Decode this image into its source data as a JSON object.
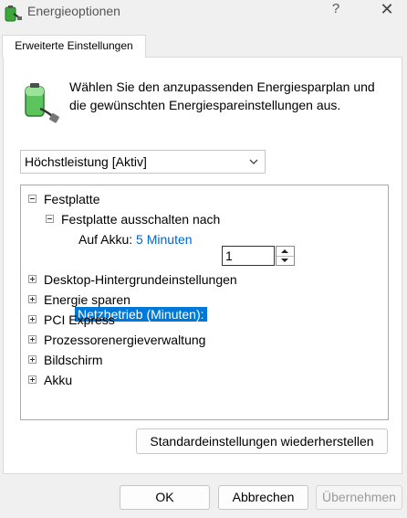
{
  "window": {
    "title": "Energieoptionen",
    "help_glyph": "?",
    "close_glyph": "✕"
  },
  "tab": {
    "label": "Erweiterte Einstellungen"
  },
  "description": "Wählen Sie den anzupassenden Energiesparplan und die gewünschten Energiespareinstellungen aus.",
  "plan_select": {
    "selected": "Höchstleistung [Aktiv]"
  },
  "tree": {
    "festplatte": {
      "label": "Festplatte",
      "expanded": true,
      "child": {
        "label": "Festplatte ausschalten nach",
        "expanded": true,
        "on_battery": {
          "label": "Auf Akku:",
          "value": "5 Minuten"
        },
        "plugged_in": {
          "label": "Netzbetrieb (Minuten):",
          "value": "1"
        }
      }
    },
    "collapsed_items": [
      "Desktop-Hintergrundeinstellungen",
      "Energie sparen",
      "PCI Express",
      "Prozessorenergieverwaltung",
      "Bildschirm",
      "Akku"
    ]
  },
  "buttons": {
    "restore": "Standardeinstellungen wiederherstellen",
    "ok": "OK",
    "cancel": "Abbrechen",
    "apply": "Übernehmen"
  },
  "colors": {
    "selection": "#0078d7",
    "link": "#0066cc",
    "disabled_text": "#9a9a9a"
  },
  "icons": {
    "app": "power-options-icon",
    "battery": "battery-plug-icon",
    "expand": "plus-box-icon",
    "collapse": "minus-box-icon"
  }
}
